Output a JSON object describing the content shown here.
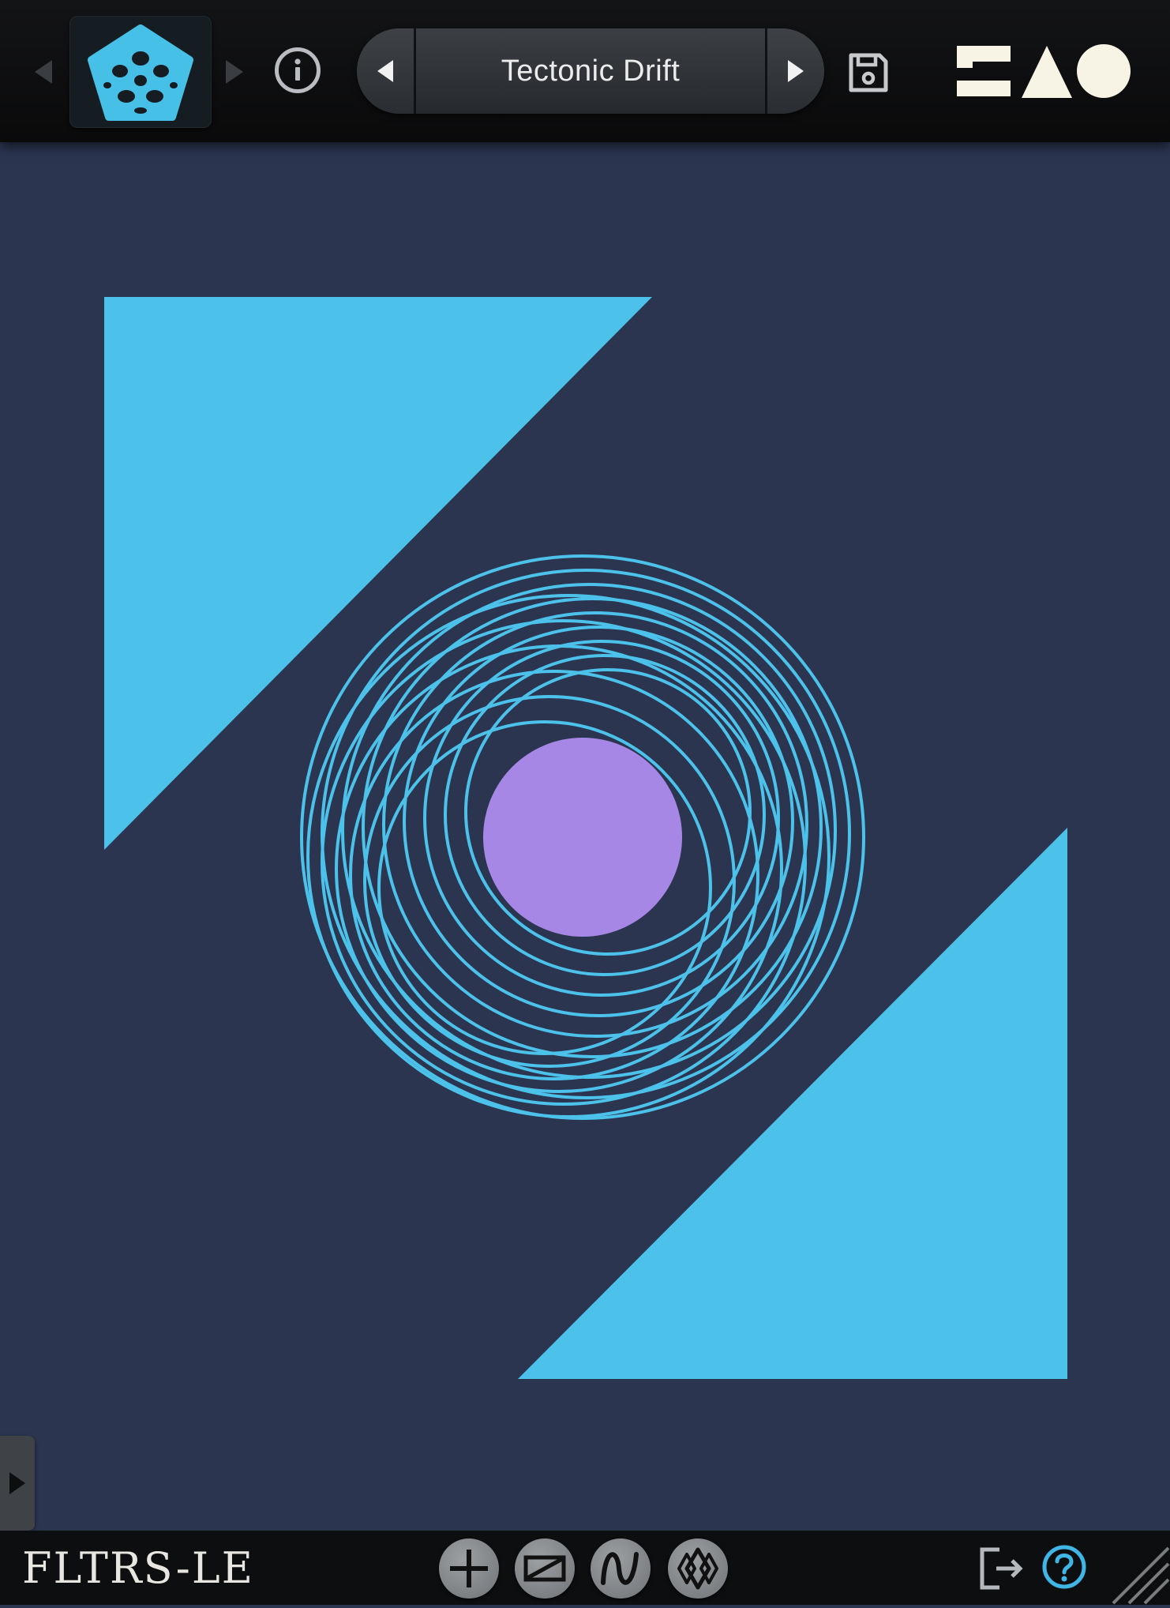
{
  "header": {
    "preset_name": "Tectonic Drift"
  },
  "footer": {
    "brand": "FLTRS-LE"
  },
  "colors": {
    "background": "#2b3550",
    "accent_cyan": "#4cc1ea",
    "accent_purple": "#a687e6",
    "topbar": "#0f1012",
    "logo_text": "#f7f4e6"
  },
  "icons": {
    "prev_algorithm": "triangle-left-icon",
    "next_algorithm": "triangle-right-icon",
    "algorithm_logo": "pentagon-star-icon",
    "info": "info-icon",
    "preset_prev": "triangle-left-icon",
    "preset_next": "triangle-right-icon",
    "save": "floppy-disk-icon",
    "company_logo": "shapes-logo-icon",
    "side_panel": "triangle-right-icon",
    "add": "plus-icon",
    "filter": "filter-shape-icon",
    "wave": "wave-icon",
    "morph": "diamond-chain-icon",
    "exit": "exit-icon",
    "help": "help-icon",
    "resize": "resize-grip-icon"
  }
}
